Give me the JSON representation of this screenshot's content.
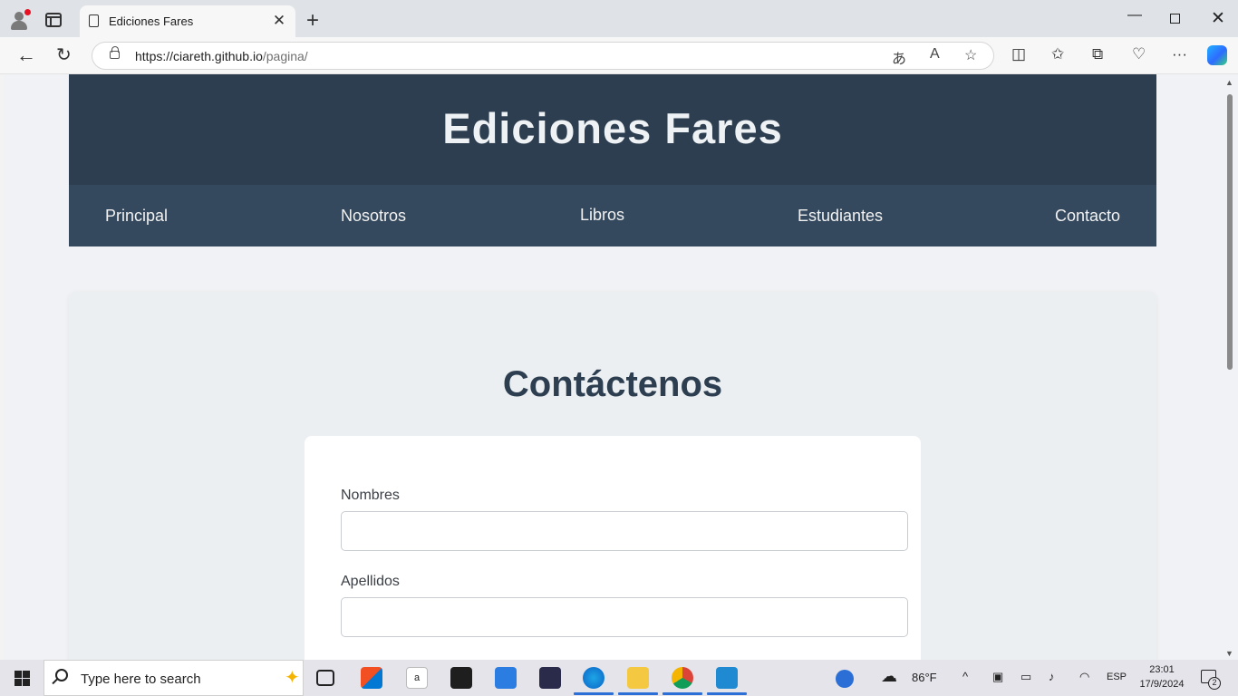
{
  "browser": {
    "tab_title": "Ediciones Fares",
    "url_host": "https://ciareth.github.io",
    "url_path": "/pagina/"
  },
  "site": {
    "title": "Ediciones Fares",
    "nav": [
      "Principal",
      "Nosotros",
      "Libros",
      "Estudiantes",
      "Contacto"
    ]
  },
  "contact": {
    "heading": "Contáctenos",
    "fields": [
      {
        "label": "Nombres",
        "value": ""
      },
      {
        "label": "Apellidos",
        "value": ""
      }
    ]
  },
  "taskbar": {
    "search_placeholder": "Type here to search",
    "weather": "86°F",
    "language": "ESP",
    "time": "23:01",
    "date": "17/9/2024",
    "notification_count": "2"
  },
  "colors": {
    "header": "#2d3e50",
    "nav": "#34495e",
    "heading": "#2c3e50"
  }
}
